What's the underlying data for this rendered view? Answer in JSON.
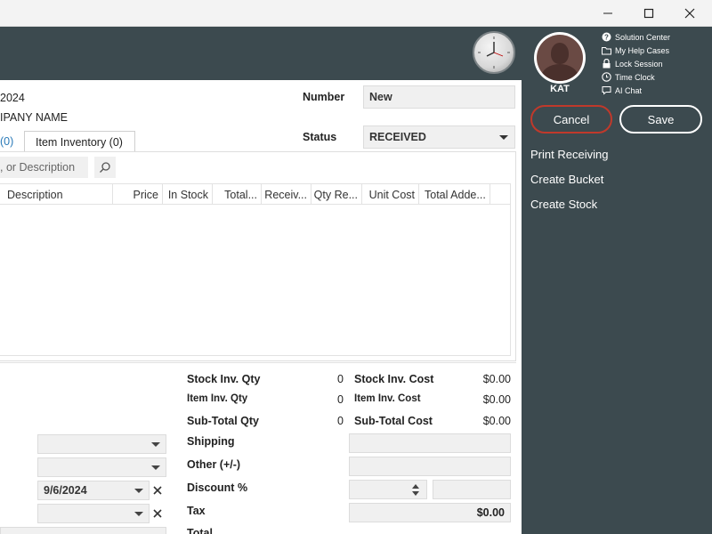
{
  "window": {
    "minimize_icon": "minimize-icon",
    "maximize_icon": "maximize-icon",
    "close_icon": "close-icon"
  },
  "header": {
    "clock_icon": "clock-icon"
  },
  "sidebar": {
    "user_name": "KAT",
    "quick_links": [
      {
        "label": "Solution Center",
        "icon": "help-icon"
      },
      {
        "label": "My Help Cases",
        "icon": "folder-icon"
      },
      {
        "label": "Lock Session",
        "icon": "lock-icon"
      },
      {
        "label": "Time Clock",
        "icon": "clock-icon"
      },
      {
        "label": "AI Chat",
        "icon": "chat-icon"
      }
    ],
    "cancel_label": "Cancel",
    "save_label": "Save",
    "actions": [
      "Print Receiving",
      "Create Bucket",
      "Create Stock"
    ],
    "accent": "#3c4a4f",
    "cancel_border": "#c0392b"
  },
  "form": {
    "date_fragment": "2024",
    "company_fragment": "IPANY NAME",
    "number_label": "Number",
    "number_value": "New",
    "status_label": "Status",
    "status_value": "RECEIVED",
    "tab_stock_fragment": "(0)",
    "tab_item_inventory": "Item Inventory (0)",
    "search_placeholder": ", or Description",
    "columns": [
      "Description",
      "Price",
      "In Stock",
      "Total...",
      "Receiv...",
      "Qty Re...",
      "Unit Cost",
      "Total Adde..."
    ]
  },
  "summary": {
    "stock_inv_qty_label": "Stock Inv. Qty",
    "stock_inv_qty": "0",
    "stock_inv_cost_label": "Stock Inv. Cost",
    "stock_inv_cost": "$0.00",
    "item_inv_qty_label": "Item Inv. Qty",
    "item_inv_qty": "0",
    "item_inv_cost_label": "Item Inv. Cost",
    "item_inv_cost": "$0.00",
    "subtotal_qty_label": "Sub-Total Qty",
    "subtotal_qty": "0",
    "subtotal_cost_label": "Sub-Total Cost",
    "subtotal_cost": "$0.00",
    "shipping_label": "Shipping",
    "other_label": "Other (+/-)",
    "discount_label": "Discount %",
    "tax_label": "Tax",
    "tax_value": "$0.00",
    "total_label": "Total"
  },
  "left_fields": {
    "date_value": "9/6/2024"
  }
}
